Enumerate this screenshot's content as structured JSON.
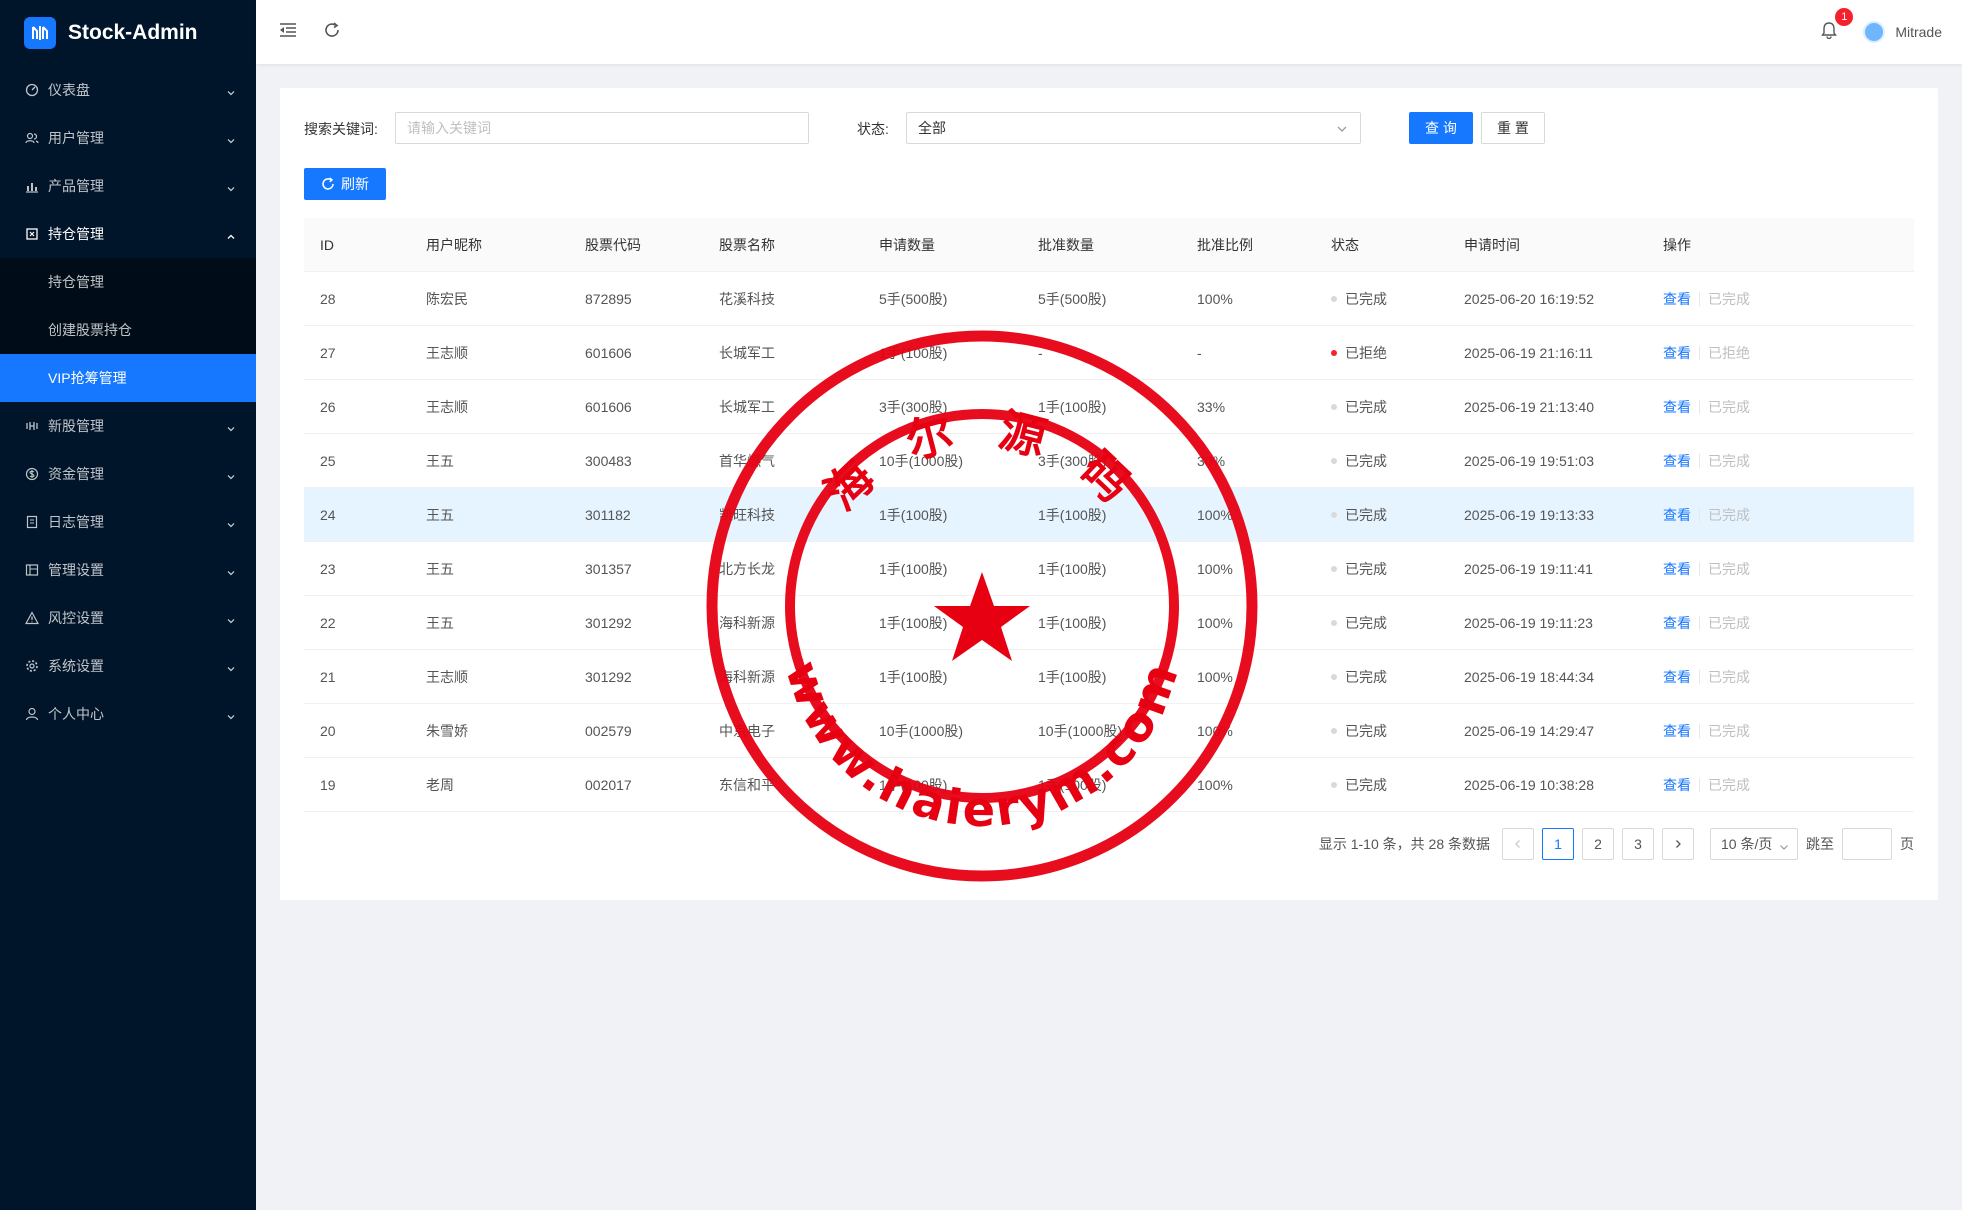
{
  "app": {
    "title": "Stock-Admin"
  },
  "sidebar": {
    "items": [
      {
        "label": "仪表盘",
        "icon": "dashboard-icon"
      },
      {
        "label": "用户管理",
        "icon": "users-icon"
      },
      {
        "label": "产品管理",
        "icon": "chart-icon"
      },
      {
        "label": "持仓管理",
        "icon": "holdings-icon",
        "open": true,
        "children": [
          {
            "label": "持仓管理"
          },
          {
            "label": "创建股票持仓"
          },
          {
            "label": "VIP抢筹管理",
            "active": true
          }
        ]
      },
      {
        "label": "新股管理",
        "icon": "ipo-icon"
      },
      {
        "label": "资金管理",
        "icon": "money-icon"
      },
      {
        "label": "日志管理",
        "icon": "log-icon"
      },
      {
        "label": "管理设置",
        "icon": "admin-settings-icon"
      },
      {
        "label": "风控设置",
        "icon": "warning-icon"
      },
      {
        "label": "系统设置",
        "icon": "gear-icon"
      },
      {
        "label": "个人中心",
        "icon": "user-icon"
      }
    ]
  },
  "header": {
    "notification_count": "1",
    "username": "Mitrade"
  },
  "search": {
    "keyword_label": "搜索关键词:",
    "keyword_placeholder": "请输入关键词",
    "status_label": "状态:",
    "status_value": "全部",
    "query_label": "查 询",
    "reset_label": "重 置",
    "refresh_label": "刷新"
  },
  "table": {
    "columns": [
      "ID",
      "用户昵称",
      "股票代码",
      "股票名称",
      "申请数量",
      "批准数量",
      "批准比例",
      "状态",
      "申请时间",
      "操作"
    ],
    "rows": [
      {
        "id": "28",
        "nickname": "陈宏民",
        "code": "872895",
        "name": "花溪科技",
        "apply": "5手(500股)",
        "approve": "5手(500股)",
        "ratio": "100%",
        "status": "已完成",
        "time": "2025-06-20 16:19:52",
        "view": "查看",
        "action": "已完成"
      },
      {
        "id": "27",
        "nickname": "王志顺",
        "code": "601606",
        "name": "长城军工",
        "apply": "1手(100股)",
        "approve": "-",
        "ratio": "-",
        "status": "已拒绝",
        "time": "2025-06-19 21:16:11",
        "view": "查看",
        "action": "已拒绝"
      },
      {
        "id": "26",
        "nickname": "王志顺",
        "code": "601606",
        "name": "长城军工",
        "apply": "3手(300股)",
        "approve": "1手(100股)",
        "ratio": "33%",
        "status": "已完成",
        "time": "2025-06-19 21:13:40",
        "view": "查看",
        "action": "已完成"
      },
      {
        "id": "25",
        "nickname": "王五",
        "code": "300483",
        "name": "首华燃气",
        "apply": "10手(1000股)",
        "approve": "3手(300股)",
        "ratio": "30%",
        "status": "已完成",
        "time": "2025-06-19 19:51:03",
        "view": "查看",
        "action": "已完成"
      },
      {
        "id": "24",
        "nickname": "王五",
        "code": "301182",
        "name": "凯旺科技",
        "apply": "1手(100股)",
        "approve": "1手(100股)",
        "ratio": "100%",
        "status": "已完成",
        "time": "2025-06-19 19:13:33",
        "view": "查看",
        "action": "已完成"
      },
      {
        "id": "23",
        "nickname": "王五",
        "code": "301357",
        "name": "北方长龙",
        "apply": "1手(100股)",
        "approve": "1手(100股)",
        "ratio": "100%",
        "status": "已完成",
        "time": "2025-06-19 19:11:41",
        "view": "查看",
        "action": "已完成"
      },
      {
        "id": "22",
        "nickname": "王五",
        "code": "301292",
        "name": "海科新源",
        "apply": "1手(100股)",
        "approve": "1手(100股)",
        "ratio": "100%",
        "status": "已完成",
        "time": "2025-06-19 19:11:23",
        "view": "查看",
        "action": "已完成"
      },
      {
        "id": "21",
        "nickname": "王志顺",
        "code": "301292",
        "name": "海科新源",
        "apply": "1手(100股)",
        "approve": "1手(100股)",
        "ratio": "100%",
        "status": "已完成",
        "time": "2025-06-19 18:44:34",
        "view": "查看",
        "action": "已完成"
      },
      {
        "id": "20",
        "nickname": "朱雪娇",
        "code": "002579",
        "name": "中京电子",
        "apply": "10手(1000股)",
        "approve": "10手(1000股)",
        "ratio": "100%",
        "status": "已完成",
        "time": "2025-06-19 14:29:47",
        "view": "查看",
        "action": "已完成"
      },
      {
        "id": "19",
        "nickname": "老周",
        "code": "002017",
        "name": "东信和平",
        "apply": "1手(100股)",
        "approve": "1手(100股)",
        "ratio": "100%",
        "status": "已完成",
        "time": "2025-06-19 10:38:28",
        "view": "查看",
        "action": "已完成"
      }
    ]
  },
  "pagination": {
    "total_text": "显示 1-10 条，共 28 条数据",
    "pages": [
      "1",
      "2",
      "3"
    ],
    "current": "1",
    "page_size": "10 条/页",
    "jump_label": "跳至",
    "page_suffix": "页"
  },
  "watermark": {
    "top_text": "海 尔 源 码",
    "bottom_text": "www.haierym.com",
    "color": "#e60012"
  },
  "colors": {
    "primary": "#1677ff",
    "sidebar_bg": "#001529",
    "danger": "#f5222d"
  }
}
